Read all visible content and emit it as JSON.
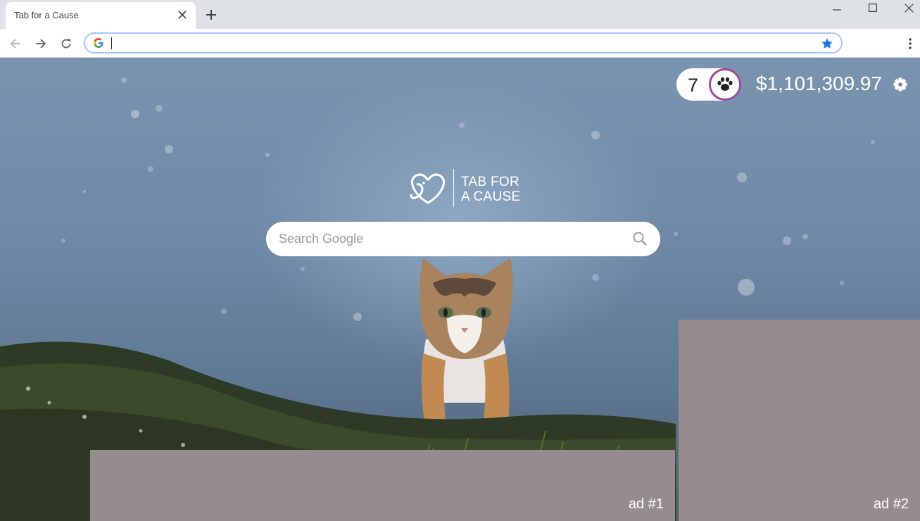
{
  "browser": {
    "tab": {
      "title": "Tab for a Cause"
    },
    "omnibox": {
      "value": "",
      "placeholder": ""
    }
  },
  "counters": {
    "hearts": "7",
    "money_raised": "$1,101,309.97"
  },
  "logo": {
    "line1": "TAB FOR",
    "line2": "A CAUSE"
  },
  "search": {
    "placeholder": "Search Google"
  },
  "ads": [
    {
      "label": "ad #1"
    },
    {
      "label": "ad #2"
    }
  ],
  "icons": {
    "tab_close": "close-icon",
    "new_tab": "plus-icon",
    "back": "arrow-left-icon",
    "forward": "arrow-right-icon",
    "reload": "reload-icon",
    "google": "google-g-icon",
    "bookmark": "star-icon",
    "menu": "kebab-menu-icon",
    "paw": "paw-icon",
    "settings": "gear-icon",
    "search": "magnifier-icon"
  },
  "colors": {
    "omnibox_focus": "#a8c7fa",
    "star": "#1a73e8",
    "paw_ring": "#9d4ba3",
    "ad_placeholder": "#968c90"
  }
}
